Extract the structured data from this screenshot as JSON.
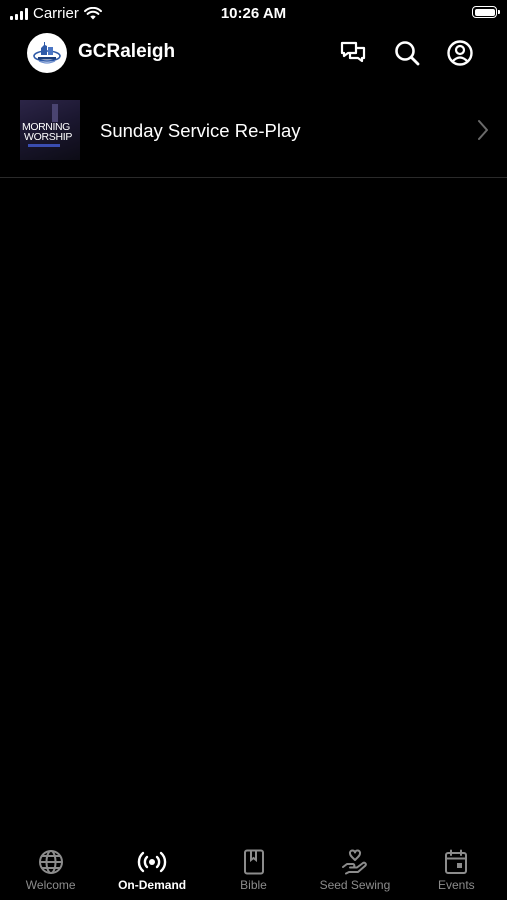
{
  "status_bar": {
    "carrier": "Carrier",
    "time": "10:26 AM"
  },
  "header": {
    "title": "GCRaleigh",
    "logo_icon": "church-logo-icon",
    "actions": [
      "chat-icon",
      "search-icon",
      "account-icon"
    ]
  },
  "list": {
    "items": [
      {
        "title": "Sunday Service Re-Play",
        "thumbnail_text_line1": "MORNING",
        "thumbnail_text_line2": "WORSHIP"
      }
    ]
  },
  "tabs": [
    {
      "label": "Welcome",
      "icon": "globe-icon",
      "active": false
    },
    {
      "label": "On-Demand",
      "icon": "broadcast-icon",
      "active": true
    },
    {
      "label": "Bible",
      "icon": "book-icon",
      "active": false
    },
    {
      "label": "Seed Sewing",
      "icon": "giving-hand-icon",
      "active": false
    },
    {
      "label": "Events",
      "icon": "calendar-icon",
      "active": false
    }
  ],
  "colors": {
    "background": "#000000",
    "text": "#ffffff",
    "tab_inactive": "#8c8c8c",
    "divider": "#2a2a2a"
  }
}
